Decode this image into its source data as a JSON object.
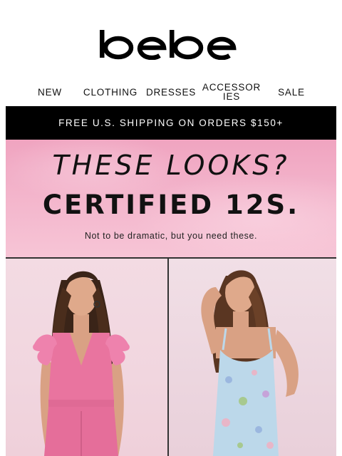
{
  "brand": {
    "logo_text": "bebe"
  },
  "nav": {
    "items": [
      {
        "label": "NEW"
      },
      {
        "label": "CLOTHING"
      },
      {
        "label": "DRESSES"
      },
      {
        "label": "ACCESSORIES"
      },
      {
        "label": "SALE"
      }
    ]
  },
  "promo": {
    "shipping_text": "FREE U.S. SHIPPING ON ORDERS $150+"
  },
  "hero": {
    "headline_line1": "THESE LOOKS?",
    "headline_line2": "CERTIFIED 12S.",
    "subtext": "Not to be dramatic, but you need these."
  },
  "colors": {
    "hero_pink": "#f3b4cb",
    "dress_pink": "#e9749f",
    "dress_blue": "#bcd8ea",
    "bar_black": "#000000"
  }
}
